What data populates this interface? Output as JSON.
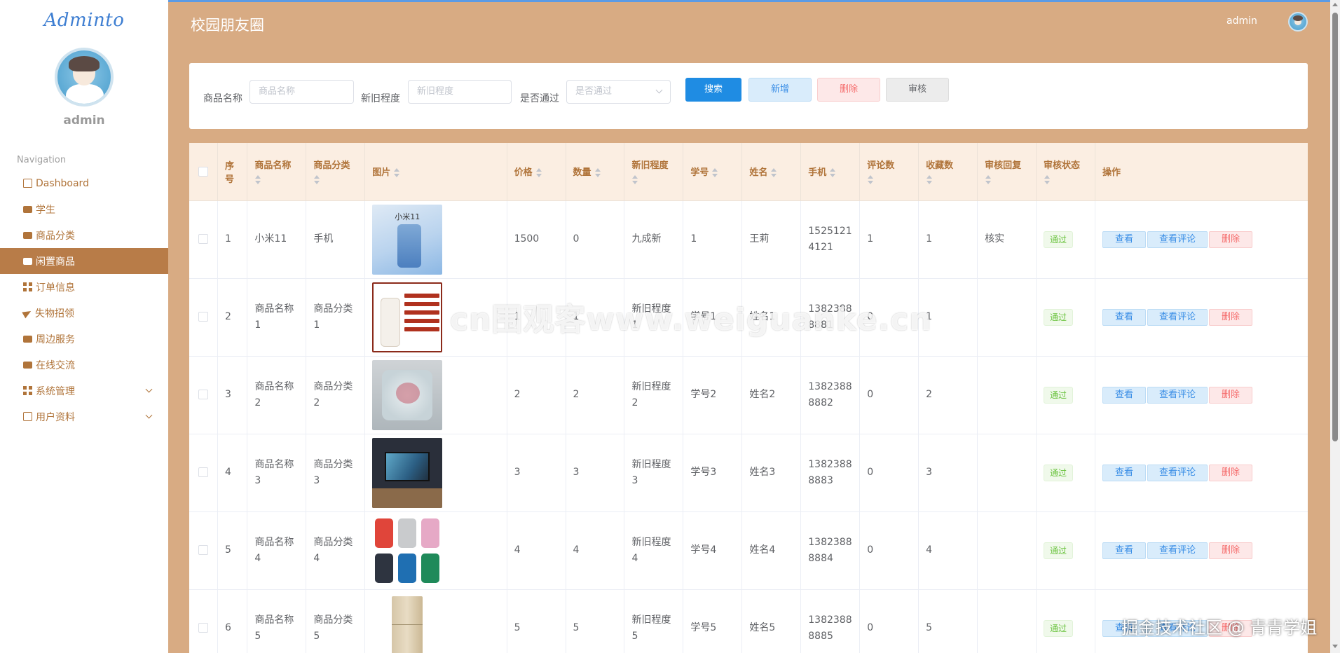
{
  "app": {
    "logo": "Adminto",
    "user": "admin"
  },
  "sidebar": {
    "heading": "Navigation",
    "items": [
      {
        "label": "Dashboard",
        "icon": "home-icon",
        "active": false
      },
      {
        "label": "学生",
        "icon": "chat-icon",
        "active": false
      },
      {
        "label": "商品分类",
        "icon": "briefcase-icon",
        "active": false
      },
      {
        "label": "闲置商品",
        "icon": "clipboard-icon",
        "active": true
      },
      {
        "label": "订单信息",
        "icon": "grid-icon",
        "active": false
      },
      {
        "label": "失物招领",
        "icon": "send-icon",
        "active": false
      },
      {
        "label": "周边服务",
        "icon": "clipboard-icon",
        "active": false
      },
      {
        "label": "在线交流",
        "icon": "thumbs-up-icon",
        "active": false
      },
      {
        "label": "系统管理",
        "icon": "grid-icon",
        "active": false,
        "expandable": true
      },
      {
        "label": "用户资料",
        "icon": "card-icon",
        "active": false,
        "expandable": true
      }
    ]
  },
  "header": {
    "title": "校园朋友圈",
    "user": "admin"
  },
  "search": {
    "name_label": "商品名称",
    "name_placeholder": "商品名称",
    "condition_label": "新旧程度",
    "condition_placeholder": "新旧程度",
    "pass_label": "是否通过",
    "pass_placeholder": "是否通过",
    "btn_search": "搜索",
    "btn_add": "新增",
    "btn_delete": "删除",
    "btn_audit": "审核"
  },
  "table": {
    "columns": [
      "序号",
      "商品名称",
      "商品分类",
      "图片",
      "价格",
      "数量",
      "新旧程度",
      "学号",
      "姓名",
      "手机",
      "评论数",
      "收藏数",
      "审核回复",
      "审核状态",
      "操作"
    ],
    "rows": [
      {
        "no": "1",
        "name": "小米11",
        "category": "手机",
        "image": "phone",
        "price": "1500",
        "qty": "0",
        "condition": "九成新",
        "student_no": "1",
        "student_name": "王莉",
        "phone": "15251214121",
        "comments": "1",
        "favorites": "1",
        "reply": "核实",
        "status": "通过"
      },
      {
        "no": "2",
        "name": "商品名称1",
        "category": "商品分类1",
        "image": "lotion",
        "price": "1",
        "qty": "1",
        "condition": "新旧程度1",
        "student_no": "学号1",
        "student_name": "姓名1",
        "phone": "13823888881",
        "comments": "0",
        "favorites": "1",
        "reply": "",
        "status": "通过"
      },
      {
        "no": "3",
        "name": "商品名称2",
        "category": "商品分类2",
        "image": "pillow",
        "price": "2",
        "qty": "2",
        "condition": "新旧程度2",
        "student_no": "学号2",
        "student_name": "姓名2",
        "phone": "13823888882",
        "comments": "0",
        "favorites": "2",
        "reply": "",
        "status": "通过"
      },
      {
        "no": "4",
        "name": "商品名称3",
        "category": "商品分类3",
        "image": "tv",
        "price": "3",
        "qty": "3",
        "condition": "新旧程度3",
        "student_no": "学号3",
        "student_name": "姓名3",
        "phone": "13823888883",
        "comments": "0",
        "favorites": "3",
        "reply": "",
        "status": "通过"
      },
      {
        "no": "5",
        "name": "商品名称4",
        "category": "商品分类4",
        "image": "speakers",
        "price": "4",
        "qty": "4",
        "condition": "新旧程度4",
        "student_no": "学号4",
        "student_name": "姓名4",
        "phone": "13823888884",
        "comments": "0",
        "favorites": "4",
        "reply": "",
        "status": "通过"
      },
      {
        "no": "6",
        "name": "商品名称5",
        "category": "商品分类5",
        "image": "fridge",
        "price": "5",
        "qty": "5",
        "condition": "新旧程度5",
        "student_no": "学号5",
        "student_name": "姓名5",
        "phone": "13823888885",
        "comments": "0",
        "favorites": "5",
        "reply": "",
        "status": "通过"
      }
    ],
    "actions": {
      "view": "查看",
      "comments": "查看评论",
      "delete": "删除"
    }
  },
  "phone_image_text": "小米11",
  "watermark": "cn围观客www.weiguanke.cn",
  "corner_mark": "掘金技术社区 @ 青青学姐",
  "colors": {
    "accent": "#d8ab83",
    "active_nav": "#b87c48",
    "primary": "#1f8ce3",
    "danger": "#f56c6c",
    "success": "#67c23a"
  }
}
